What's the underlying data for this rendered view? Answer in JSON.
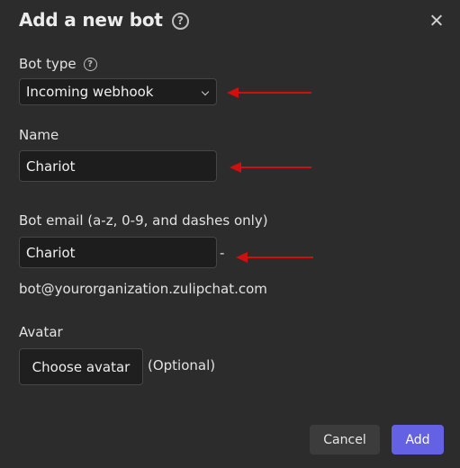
{
  "modal": {
    "title": "Add a new bot",
    "help_glyph": "?",
    "close_icon": "close-icon"
  },
  "bot_type": {
    "label": "Bot type",
    "help_glyph": "?",
    "selected": "Incoming webhook"
  },
  "name": {
    "label": "Name",
    "value": "Chariot"
  },
  "email": {
    "label": "Bot email (a-z, 0-9, and dashes only)",
    "value": "Chariot",
    "separator": "-",
    "domain": "bot@yourorganization.zulipchat.com"
  },
  "avatar": {
    "label": "Avatar",
    "button": "Choose avatar",
    "optional": "(Optional)"
  },
  "footer": {
    "cancel": "Cancel",
    "add": "Add"
  },
  "colors": {
    "background": "#2c2c2c",
    "input_bg": "#1d1d1d",
    "accent": "#6461e4",
    "annotation_arrow": "#d10f0f"
  }
}
